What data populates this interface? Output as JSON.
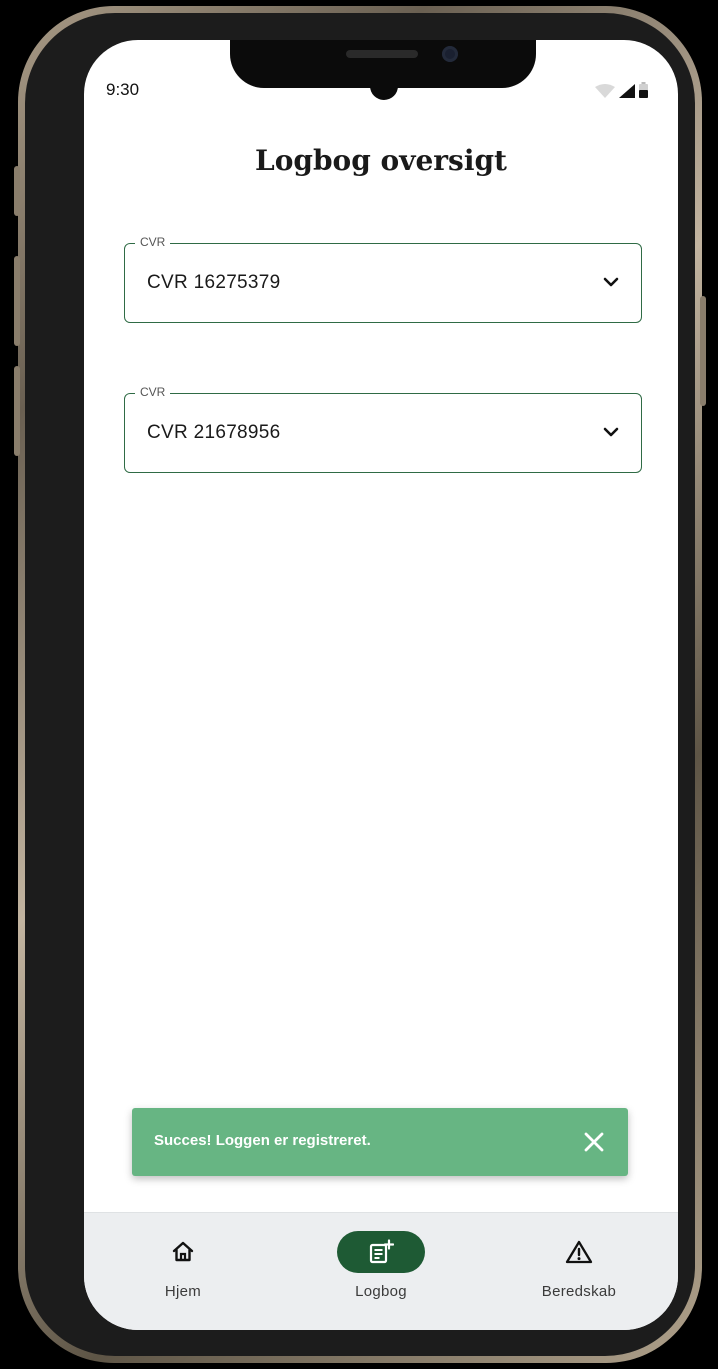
{
  "status_bar": {
    "time": "9:30"
  },
  "page": {
    "title": "Logbog oversigt"
  },
  "cvr_selects": [
    {
      "legend": "CVR",
      "value": "CVR 16275379"
    },
    {
      "legend": "CVR",
      "value": "CVR 21678956"
    }
  ],
  "toast": {
    "message": "Succes! Loggen er registreret.",
    "color": "#67b583"
  },
  "bottom_nav": {
    "items": [
      {
        "label": "Hjem",
        "icon": "home-icon",
        "active": false
      },
      {
        "label": "Logbog",
        "icon": "logbook-add-icon",
        "active": true
      },
      {
        "label": "Beredskab",
        "icon": "warning-icon",
        "active": false
      }
    ],
    "active_color": "#1e5a34"
  },
  "colors": {
    "accent": "#2f6b45",
    "frame": "#1c1c1c"
  }
}
